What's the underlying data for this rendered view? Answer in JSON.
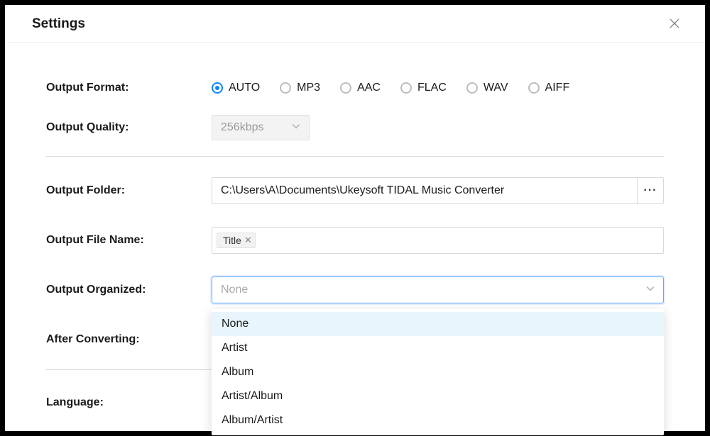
{
  "title": "Settings",
  "labels": {
    "outputFormat": "Output Format:",
    "outputQuality": "Output Quality:",
    "outputFolder": "Output Folder:",
    "outputFileName": "Output File Name:",
    "outputOrganized": "Output Organized:",
    "afterConverting": "After Converting:",
    "language": "Language:"
  },
  "formatOptions": [
    "AUTO",
    "MP3",
    "AAC",
    "FLAC",
    "WAV",
    "AIFF"
  ],
  "formatSelected": "AUTO",
  "quality": {
    "value": "256kbps",
    "disabled": true
  },
  "folder": {
    "path": "C:\\Users\\A\\Documents\\Ukeysoft TIDAL Music Converter"
  },
  "fileNameTags": [
    "Title"
  ],
  "organized": {
    "placeholder": "None",
    "options": [
      "None",
      "Artist",
      "Album",
      "Artist/Album",
      "Album/Artist"
    ],
    "highlighted": "None"
  }
}
